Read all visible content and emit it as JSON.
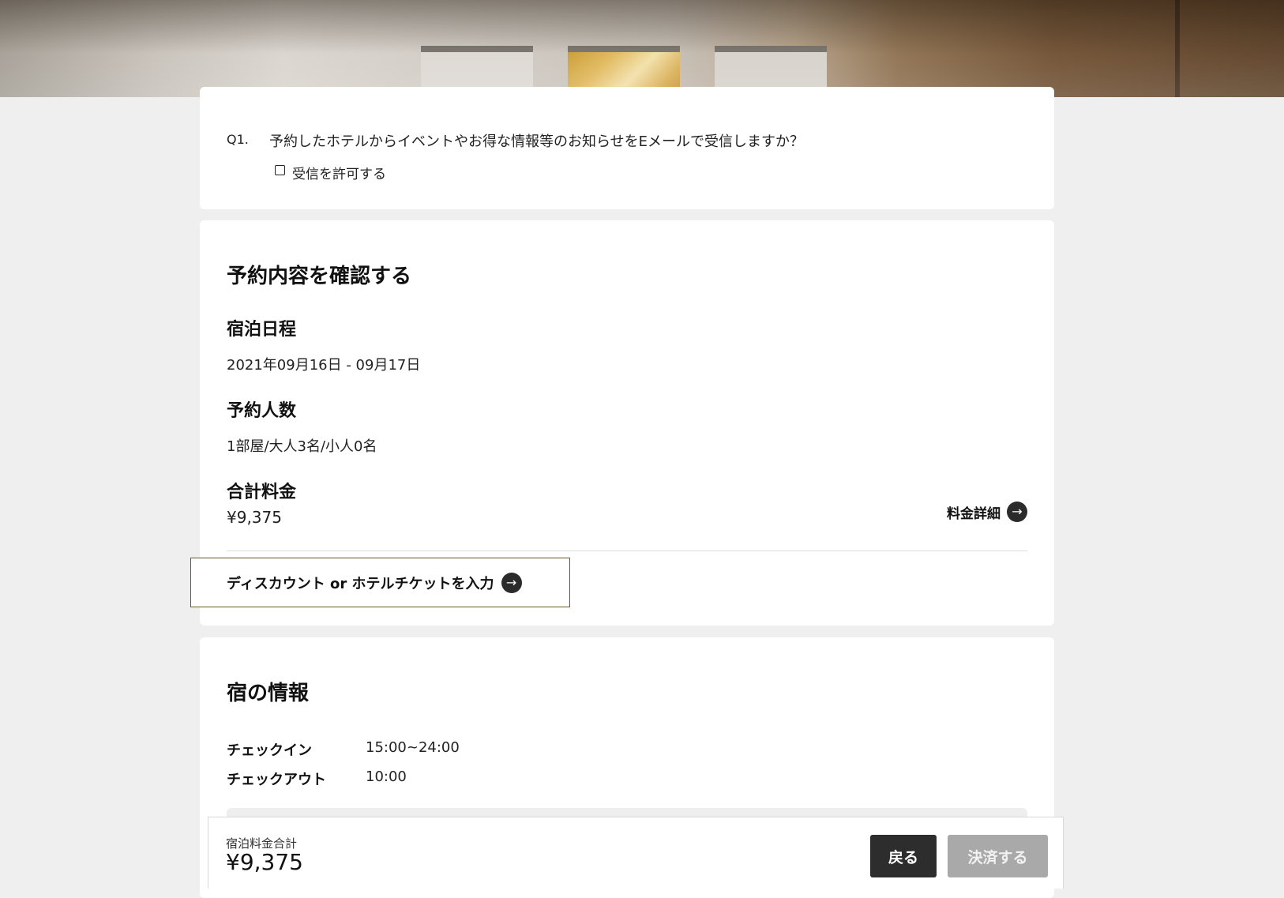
{
  "question": {
    "number": "Q1.",
    "text": "予約したホテルからイベントやお得な情報等のお知らせをEメールで受信しますか？",
    "option_label": "受信を許可する",
    "option_checked": false
  },
  "confirm": {
    "title": "予約内容を確認する",
    "stay_label": "宿泊日程",
    "stay_value": "2021年09月16日  - 09月17日",
    "guests_label": "予約人数",
    "guests_value": "1部屋/大人3名/小人0名",
    "total_label": "合計料金",
    "total_value": "¥9,375",
    "detail_link": "料金詳細",
    "discount_link": "ディスカウント or ホテルチケットを入力"
  },
  "hotel_info": {
    "title": "宿の情報",
    "rows": [
      {
        "key": "チェックイン",
        "value": "15:00~24:00"
      },
      {
        "key": "チェックアウト",
        "value": "10:00"
      }
    ]
  },
  "footer": {
    "label": "宿泊料金合計",
    "total": "¥9,375",
    "back_label": "戻る",
    "pay_label": "決済する",
    "pay_enabled": false
  },
  "icons": {
    "arrow": "arrow-right-circle-icon",
    "checkbox": "checkbox-icon"
  },
  "colors": {
    "page_bg": "#efefef",
    "card_bg": "#ffffff",
    "dark_button": "#2d2d2d",
    "disabled_button": "#a9a9a9",
    "focus_outline": "#6b5a1f"
  }
}
